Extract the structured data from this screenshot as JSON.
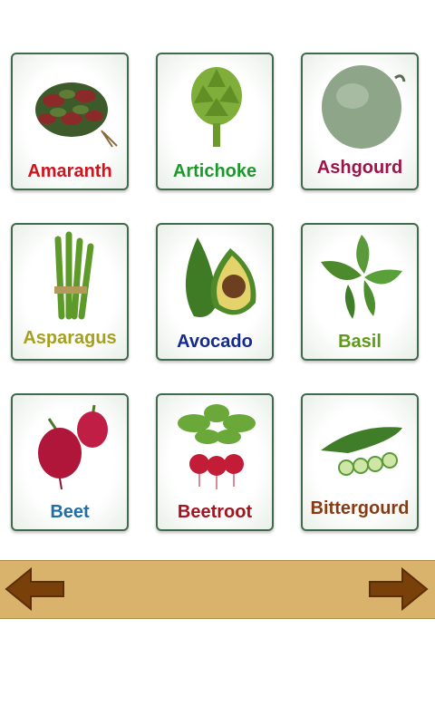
{
  "cards": [
    {
      "name": "Amaranth",
      "color": "#d3121b"
    },
    {
      "name": "Artichoke",
      "color": "#1a9a2b"
    },
    {
      "name": "Ashgourd",
      "color": "#a01346"
    },
    {
      "name": "Asparagus",
      "color": "#a5a11c"
    },
    {
      "name": "Avocado",
      "color": "#142a8e"
    },
    {
      "name": "Basil",
      "color": "#5e9a19"
    },
    {
      "name": "Beet",
      "color": "#1f6fa6"
    },
    {
      "name": "Beetroot",
      "color": "#a3141e"
    },
    {
      "name": "Bittergourd",
      "color": "#8a3a12"
    }
  ],
  "nav": {
    "prev_icon": "left-arrow-icon",
    "next_icon": "right-arrow-icon",
    "bar_color": "#d9b36b",
    "arrow_color": "#7a4009"
  }
}
